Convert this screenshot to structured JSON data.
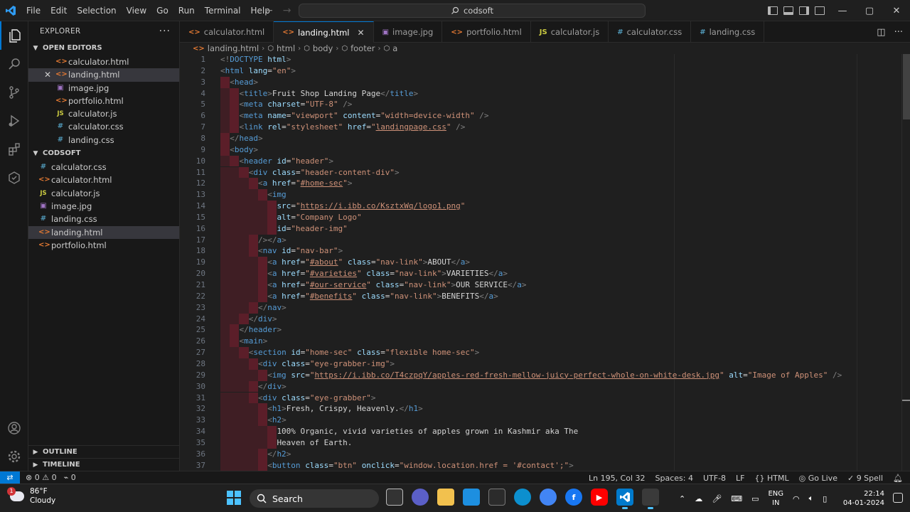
{
  "titlebar": {
    "menu": [
      "File",
      "Edit",
      "Selection",
      "View",
      "Go",
      "Run",
      "Terminal",
      "Help"
    ],
    "search": "codsoft"
  },
  "sidebar": {
    "title": "EXPLORER",
    "open_editors_title": "OPEN EDITORS",
    "open_editors": [
      {
        "name": "calculator.html",
        "type": "html"
      },
      {
        "name": "landing.html",
        "type": "html",
        "selected": true
      },
      {
        "name": "image.jpg",
        "type": "img"
      },
      {
        "name": "portfolio.html",
        "type": "html"
      },
      {
        "name": "calculator.js",
        "type": "js"
      },
      {
        "name": "calculator.css",
        "type": "css"
      },
      {
        "name": "landing.css",
        "type": "css"
      }
    ],
    "folder_title": "CODSOFT",
    "files": [
      {
        "name": "calculator.css",
        "type": "css"
      },
      {
        "name": "calculator.html",
        "type": "html"
      },
      {
        "name": "calculator.js",
        "type": "js"
      },
      {
        "name": "image.jpg",
        "type": "img"
      },
      {
        "name": "landing.css",
        "type": "css"
      },
      {
        "name": "landing.html",
        "type": "html",
        "selected": true
      },
      {
        "name": "portfolio.html",
        "type": "html"
      }
    ],
    "outline": "OUTLINE",
    "timeline": "TIMELINE"
  },
  "tabs": [
    {
      "label": "calculator.html",
      "type": "html"
    },
    {
      "label": "landing.html",
      "type": "html",
      "active": true
    },
    {
      "label": "image.jpg",
      "type": "img"
    },
    {
      "label": "portfolio.html",
      "type": "html"
    },
    {
      "label": "calculator.js",
      "type": "js"
    },
    {
      "label": "calculator.css",
      "type": "css"
    },
    {
      "label": "landing.css",
      "type": "css"
    }
  ],
  "breadcrumb": [
    "landing.html",
    "html",
    "body",
    "footer",
    "a"
  ],
  "code_lines": [
    {
      "n": 1,
      "i": 0,
      "t": [
        [
          "br",
          "<!"
        ],
        [
          "tag",
          "DOCTYPE"
        ],
        [
          "txt",
          " "
        ],
        [
          "attr",
          "html"
        ],
        [
          "br",
          ">"
        ]
      ]
    },
    {
      "n": 2,
      "i": 0,
      "t": [
        [
          "br",
          "<"
        ],
        [
          "tag",
          "html"
        ],
        [
          "txt",
          " "
        ],
        [
          "attr",
          "lang"
        ],
        [
          "txt",
          "="
        ],
        [
          "str",
          "\"en\""
        ],
        [
          "br",
          ">"
        ]
      ]
    },
    {
      "n": 3,
      "i": 1,
      "t": [
        [
          "br",
          "<"
        ],
        [
          "tag",
          "head"
        ],
        [
          "br",
          ">"
        ]
      ]
    },
    {
      "n": 4,
      "i": 2,
      "t": [
        [
          "br",
          "<"
        ],
        [
          "tag",
          "title"
        ],
        [
          "br",
          ">"
        ],
        [
          "txt",
          "Fruit Shop Landing Page"
        ],
        [
          "br",
          "</"
        ],
        [
          "tag",
          "title"
        ],
        [
          "br",
          ">"
        ]
      ]
    },
    {
      "n": 5,
      "i": 2,
      "t": [
        [
          "br",
          "<"
        ],
        [
          "tag",
          "meta"
        ],
        [
          "txt",
          " "
        ],
        [
          "attr",
          "charset"
        ],
        [
          "txt",
          "="
        ],
        [
          "str",
          "\"UTF-8\""
        ],
        [
          "txt",
          " "
        ],
        [
          "br",
          "/>"
        ]
      ]
    },
    {
      "n": 6,
      "i": 2,
      "t": [
        [
          "br",
          "<"
        ],
        [
          "tag",
          "meta"
        ],
        [
          "txt",
          " "
        ],
        [
          "attr",
          "name"
        ],
        [
          "txt",
          "="
        ],
        [
          "str",
          "\"viewport\""
        ],
        [
          "txt",
          " "
        ],
        [
          "attr",
          "content"
        ],
        [
          "txt",
          "="
        ],
        [
          "str",
          "\"width=device-width\""
        ],
        [
          "txt",
          " "
        ],
        [
          "br",
          "/>"
        ]
      ]
    },
    {
      "n": 7,
      "i": 2,
      "t": [
        [
          "br",
          "<"
        ],
        [
          "tag",
          "link"
        ],
        [
          "txt",
          " "
        ],
        [
          "attr",
          "rel"
        ],
        [
          "txt",
          "="
        ],
        [
          "str",
          "\"stylesheet\""
        ],
        [
          "txt",
          " "
        ],
        [
          "attr",
          "href"
        ],
        [
          "txt",
          "="
        ],
        [
          "str",
          "\""
        ],
        [
          "stru",
          "landingpage.css"
        ],
        [
          "str",
          "\""
        ],
        [
          "txt",
          " "
        ],
        [
          "br",
          "/>"
        ]
      ]
    },
    {
      "n": 8,
      "i": 1,
      "t": [
        [
          "br",
          "</"
        ],
        [
          "tag",
          "head"
        ],
        [
          "br",
          ">"
        ]
      ]
    },
    {
      "n": 9,
      "i": 1,
      "t": [
        [
          "br",
          "<"
        ],
        [
          "tag",
          "body"
        ],
        [
          "br",
          ">"
        ]
      ]
    },
    {
      "n": 10,
      "i": 2,
      "t": [
        [
          "br",
          "<"
        ],
        [
          "tag",
          "header"
        ],
        [
          "txt",
          " "
        ],
        [
          "attr",
          "id"
        ],
        [
          "txt",
          "="
        ],
        [
          "str",
          "\"header\""
        ],
        [
          "br",
          ">"
        ]
      ]
    },
    {
      "n": 11,
      "i": 3,
      "t": [
        [
          "br",
          "<"
        ],
        [
          "tag",
          "div"
        ],
        [
          "txt",
          " "
        ],
        [
          "attr",
          "class"
        ],
        [
          "txt",
          "="
        ],
        [
          "str",
          "\"header-content-div\""
        ],
        [
          "br",
          ">"
        ]
      ]
    },
    {
      "n": 12,
      "i": 4,
      "t": [
        [
          "br",
          "<"
        ],
        [
          "tag",
          "a"
        ],
        [
          "txt",
          " "
        ],
        [
          "attr",
          "href"
        ],
        [
          "txt",
          "="
        ],
        [
          "str",
          "\""
        ],
        [
          "stru",
          "#home-sec"
        ],
        [
          "str",
          "\""
        ],
        [
          "br",
          ">"
        ]
      ]
    },
    {
      "n": 13,
      "i": 5,
      "t": [
        [
          "br",
          "<"
        ],
        [
          "tag",
          "img"
        ]
      ]
    },
    {
      "n": 14,
      "i": 6,
      "t": [
        [
          "attr",
          "src"
        ],
        [
          "txt",
          "="
        ],
        [
          "str",
          "\""
        ],
        [
          "stru",
          "https://i.ibb.co/KsztxWq/logo1.png"
        ],
        [
          "str",
          "\""
        ]
      ]
    },
    {
      "n": 15,
      "i": 6,
      "t": [
        [
          "attr",
          "alt"
        ],
        [
          "txt",
          "="
        ],
        [
          "str",
          "\"Company Logo\""
        ]
      ]
    },
    {
      "n": 16,
      "i": 6,
      "t": [
        [
          "attr",
          "id"
        ],
        [
          "txt",
          "="
        ],
        [
          "str",
          "\"header-img\""
        ]
      ]
    },
    {
      "n": 17,
      "i": 4,
      "t": [
        [
          "br",
          "/></"
        ],
        [
          "tag",
          "a"
        ],
        [
          "br",
          ">"
        ]
      ]
    },
    {
      "n": 18,
      "i": 4,
      "t": [
        [
          "br",
          "<"
        ],
        [
          "tag",
          "nav"
        ],
        [
          "txt",
          " "
        ],
        [
          "attr",
          "id"
        ],
        [
          "txt",
          "="
        ],
        [
          "str",
          "\"nav-bar\""
        ],
        [
          "br",
          ">"
        ]
      ]
    },
    {
      "n": 19,
      "i": 5,
      "t": [
        [
          "br",
          "<"
        ],
        [
          "tag",
          "a"
        ],
        [
          "txt",
          " "
        ],
        [
          "attr",
          "href"
        ],
        [
          "txt",
          "="
        ],
        [
          "str",
          "\""
        ],
        [
          "stru",
          "#about"
        ],
        [
          "str",
          "\""
        ],
        [
          "txt",
          " "
        ],
        [
          "attr",
          "class"
        ],
        [
          "txt",
          "="
        ],
        [
          "str",
          "\"nav-link\""
        ],
        [
          "br",
          ">"
        ],
        [
          "txt",
          "ABOUT"
        ],
        [
          "br",
          "</"
        ],
        [
          "tag",
          "a"
        ],
        [
          "br",
          ">"
        ]
      ]
    },
    {
      "n": 20,
      "i": 5,
      "t": [
        [
          "br",
          "<"
        ],
        [
          "tag",
          "a"
        ],
        [
          "txt",
          " "
        ],
        [
          "attr",
          "href"
        ],
        [
          "txt",
          "="
        ],
        [
          "str",
          "\""
        ],
        [
          "stru",
          "#varieties"
        ],
        [
          "str",
          "\""
        ],
        [
          "txt",
          " "
        ],
        [
          "attr",
          "class"
        ],
        [
          "txt",
          "="
        ],
        [
          "str",
          "\"nav-link\""
        ],
        [
          "br",
          ">"
        ],
        [
          "txt",
          "VARIETIES"
        ],
        [
          "br",
          "</"
        ],
        [
          "tag",
          "a"
        ],
        [
          "br",
          ">"
        ]
      ]
    },
    {
      "n": 21,
      "i": 5,
      "t": [
        [
          "br",
          "<"
        ],
        [
          "tag",
          "a"
        ],
        [
          "txt",
          " "
        ],
        [
          "attr",
          "href"
        ],
        [
          "txt",
          "="
        ],
        [
          "str",
          "\""
        ],
        [
          "stru",
          "#our-service"
        ],
        [
          "str",
          "\""
        ],
        [
          "txt",
          " "
        ],
        [
          "attr",
          "class"
        ],
        [
          "txt",
          "="
        ],
        [
          "str",
          "\"nav-link\""
        ],
        [
          "br",
          ">"
        ],
        [
          "txt",
          "OUR SERVICE"
        ],
        [
          "br",
          "</"
        ],
        [
          "tag",
          "a"
        ],
        [
          "br",
          ">"
        ]
      ]
    },
    {
      "n": 22,
      "i": 5,
      "t": [
        [
          "br",
          "<"
        ],
        [
          "tag",
          "a"
        ],
        [
          "txt",
          " "
        ],
        [
          "attr",
          "href"
        ],
        [
          "txt",
          "="
        ],
        [
          "str",
          "\""
        ],
        [
          "stru",
          "#benefits"
        ],
        [
          "str",
          "\""
        ],
        [
          "txt",
          " "
        ],
        [
          "attr",
          "class"
        ],
        [
          "txt",
          "="
        ],
        [
          "str",
          "\"nav-link\""
        ],
        [
          "br",
          ">"
        ],
        [
          "txt",
          "BENEFITS"
        ],
        [
          "br",
          "</"
        ],
        [
          "tag",
          "a"
        ],
        [
          "br",
          ">"
        ]
      ]
    },
    {
      "n": 23,
      "i": 4,
      "t": [
        [
          "br",
          "</"
        ],
        [
          "tag",
          "nav"
        ],
        [
          "br",
          ">"
        ]
      ]
    },
    {
      "n": 24,
      "i": 3,
      "t": [
        [
          "br",
          "</"
        ],
        [
          "tag",
          "div"
        ],
        [
          "br",
          ">"
        ]
      ]
    },
    {
      "n": 25,
      "i": 2,
      "t": [
        [
          "br",
          "</"
        ],
        [
          "tag",
          "header"
        ],
        [
          "br",
          ">"
        ]
      ]
    },
    {
      "n": 26,
      "i": 2,
      "t": [
        [
          "br",
          "<"
        ],
        [
          "tag",
          "main"
        ],
        [
          "br",
          ">"
        ]
      ]
    },
    {
      "n": 27,
      "i": 3,
      "t": [
        [
          "br",
          "<"
        ],
        [
          "tag",
          "section"
        ],
        [
          "txt",
          " "
        ],
        [
          "attr",
          "id"
        ],
        [
          "txt",
          "="
        ],
        [
          "str",
          "\"home-sec\""
        ],
        [
          "txt",
          " "
        ],
        [
          "attr",
          "class"
        ],
        [
          "txt",
          "="
        ],
        [
          "str",
          "\"flexible home-sec\""
        ],
        [
          "br",
          ">"
        ]
      ]
    },
    {
      "n": 28,
      "i": 4,
      "t": [
        [
          "br",
          "<"
        ],
        [
          "tag",
          "div"
        ],
        [
          "txt",
          " "
        ],
        [
          "attr",
          "class"
        ],
        [
          "txt",
          "="
        ],
        [
          "str",
          "\"eye-grabber-img\""
        ],
        [
          "br",
          ">"
        ]
      ]
    },
    {
      "n": 29,
      "i": 5,
      "t": [
        [
          "br",
          "<"
        ],
        [
          "tag",
          "img"
        ],
        [
          "txt",
          " "
        ],
        [
          "attr",
          "src"
        ],
        [
          "txt",
          "="
        ],
        [
          "str",
          "\""
        ],
        [
          "stru",
          "https://i.ibb.co/T4czpqY/apples-red-fresh-mellow-juicy-perfect-whole-on-white-desk.jpg"
        ],
        [
          "str",
          "\""
        ],
        [
          "txt",
          " "
        ],
        [
          "attr",
          "alt"
        ],
        [
          "txt",
          "="
        ],
        [
          "str",
          "\"Image of Apples\""
        ],
        [
          "txt",
          " "
        ],
        [
          "br",
          "/>"
        ]
      ]
    },
    {
      "n": 30,
      "i": 4,
      "t": [
        [
          "br",
          "</"
        ],
        [
          "tag",
          "div"
        ],
        [
          "br",
          ">"
        ]
      ]
    },
    {
      "n": 31,
      "i": 4,
      "t": [
        [
          "br",
          "<"
        ],
        [
          "tag",
          "div"
        ],
        [
          "txt",
          " "
        ],
        [
          "attr",
          "class"
        ],
        [
          "txt",
          "="
        ],
        [
          "str",
          "\"eye-grabber\""
        ],
        [
          "br",
          ">"
        ]
      ]
    },
    {
      "n": 32,
      "i": 5,
      "t": [
        [
          "br",
          "<"
        ],
        [
          "tag",
          "h1"
        ],
        [
          "br",
          ">"
        ],
        [
          "txt",
          "Fresh, Crispy, Heavenly."
        ],
        [
          "br",
          "</"
        ],
        [
          "tag",
          "h1"
        ],
        [
          "br",
          ">"
        ]
      ]
    },
    {
      "n": 33,
      "i": 5,
      "t": [
        [
          "br",
          "<"
        ],
        [
          "tag",
          "h2"
        ],
        [
          "br",
          ">"
        ]
      ]
    },
    {
      "n": 34,
      "i": 6,
      "t": [
        [
          "txt",
          "100% Organic, vivid varieties of apples grown in Kashmir aka The"
        ]
      ]
    },
    {
      "n": 35,
      "i": 6,
      "t": [
        [
          "txt",
          "Heaven of Earth."
        ]
      ]
    },
    {
      "n": 36,
      "i": 5,
      "t": [
        [
          "br",
          "</"
        ],
        [
          "tag",
          "h2"
        ],
        [
          "br",
          ">"
        ]
      ]
    },
    {
      "n": 37,
      "i": 5,
      "t": [
        [
          "br",
          "<"
        ],
        [
          "tag",
          "button"
        ],
        [
          "txt",
          " "
        ],
        [
          "attr",
          "class"
        ],
        [
          "txt",
          "="
        ],
        [
          "str",
          "\"btn\""
        ],
        [
          "txt",
          " "
        ],
        [
          "attr",
          "onclick"
        ],
        [
          "txt",
          "="
        ],
        [
          "str",
          "\"window.location.href = '#contact';\""
        ],
        [
          "br",
          ">"
        ]
      ]
    }
  ],
  "statusbar": {
    "errors": "0",
    "warnings": "0",
    "ports": "0",
    "position": "Ln 195, Col 32",
    "spaces": "Spaces: 4",
    "encoding": "UTF-8",
    "eol": "LF",
    "language": "HTML",
    "golive": "Go Live",
    "spell": "9 Spell"
  },
  "taskbar": {
    "weather_temp": "86°F",
    "weather_desc": "Cloudy",
    "weather_badge": "1",
    "search": "Search",
    "lang_1": "ENG",
    "lang_2": "IN",
    "time": "22:14",
    "date": "04-01-2024"
  },
  "colors": {
    "accent": "#0078d4",
    "tag": "#569cd6",
    "attr": "#9cdcfe",
    "string": "#ce9178",
    "indent_error": "#8c1e32"
  }
}
